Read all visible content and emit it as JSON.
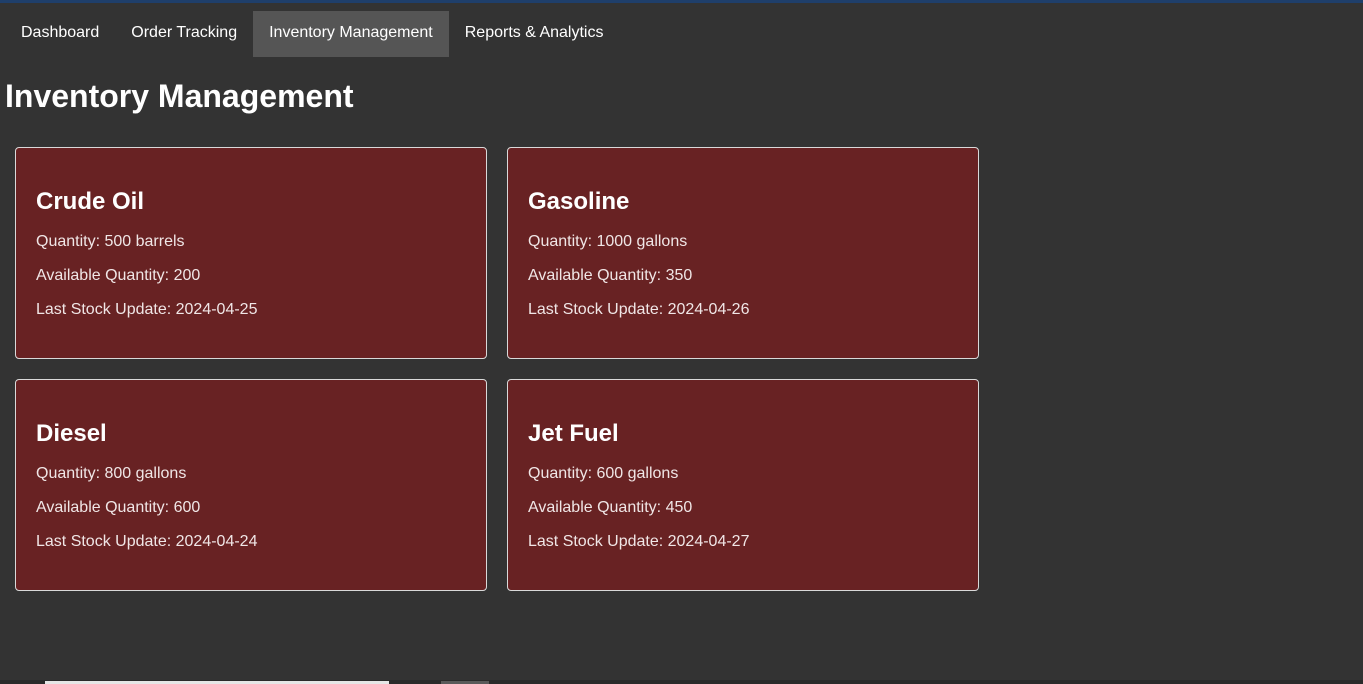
{
  "nav": {
    "items": [
      {
        "label": "Dashboard"
      },
      {
        "label": "Order Tracking"
      },
      {
        "label": "Inventory Management"
      },
      {
        "label": "Reports & Analytics"
      }
    ],
    "active": "Inventory Management"
  },
  "page": {
    "title": "Inventory Management"
  },
  "cards": [
    {
      "title": "Crude Oil",
      "quantity": "Quantity: 500 barrels",
      "available": "Available Quantity: 200",
      "updated": "Last Stock Update: 2024-04-25"
    },
    {
      "title": "Gasoline",
      "quantity": "Quantity: 1000 gallons",
      "available": "Available Quantity: 350",
      "updated": "Last Stock Update: 2024-04-26"
    },
    {
      "title": "Diesel",
      "quantity": "Quantity: 800 gallons",
      "available": "Available Quantity: 600",
      "updated": "Last Stock Update: 2024-04-24"
    },
    {
      "title": "Jet Fuel",
      "quantity": "Quantity: 600 gallons",
      "available": "Available Quantity: 450",
      "updated": "Last Stock Update: 2024-04-27"
    }
  ],
  "colors": {
    "background": "#333333",
    "card_background": "#682223",
    "active_tab": "#555555",
    "top_accent": "#1f3f6b"
  }
}
